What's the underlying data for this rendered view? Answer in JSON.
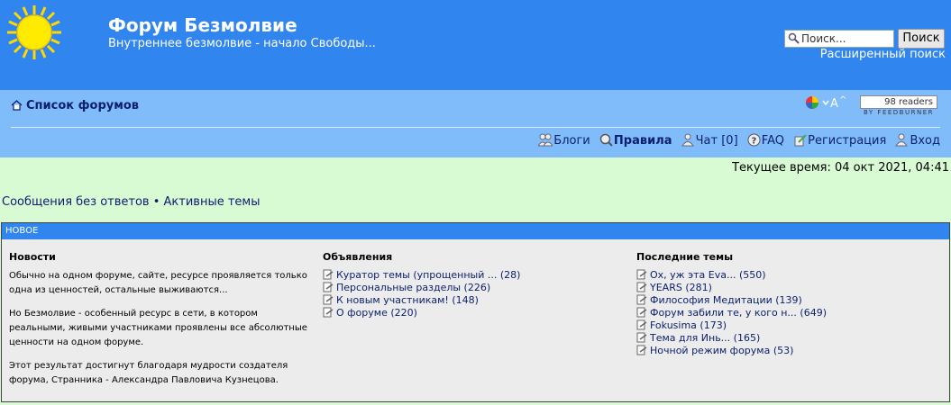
{
  "header": {
    "title": "Форум Безмолвие",
    "description": "Внутреннее безмолвие - начало Свободы...",
    "search_placeholder": "Поиск...",
    "search_button": "Поиск",
    "advanced_search": "Расширенный поиск"
  },
  "navbar": {
    "home_label": "Список форумов",
    "feed_count": "98 readers",
    "feed_by": "BY FEEDBURNER",
    "links": {
      "blogs": "Блоги",
      "rules": "Правила",
      "chat": "Чат [0]",
      "faq": "FAQ",
      "register": "Регистрация",
      "login": "Вход"
    }
  },
  "current_time": "Текущее время: 04 окт 2021, 04:41",
  "quick_links": {
    "unanswered": "Сообщения без ответов",
    "separator": " • ",
    "active": "Активные темы"
  },
  "panel": {
    "title": "НОВОЕ",
    "news": {
      "heading": "Новости",
      "paragraphs": [
        "Обычно на одном форуме, сайте, ресурсе проявляется только одна из ценностей, остальные выживаются...",
        "Но Безмолвие - особенный ресурс в сети, в котором реальными, живыми участниками проявлены все абсолютные ценности на одном форуме.",
        "Этот результат достигнут благодаря мудрости создателя форума, Странника - Александра Павловича Кузнецова."
      ]
    },
    "announcements": {
      "heading": "Объявления",
      "items": [
        "Куратор темы (упрощенный ... (28)",
        "Персональные разделы (226)",
        "К новым участникам! (148)",
        "О форуме (220)"
      ]
    },
    "latest": {
      "heading": "Последние темы",
      "items": [
        "Ох, уж эта Eva... (550)",
        "YEARS (281)",
        "Философия Медитации (139)",
        "Форум забили те, у кого н... (649)",
        "Fokusima (173)",
        "Тема для Инь... (165)",
        "Ночной режим форума (53)"
      ]
    }
  }
}
